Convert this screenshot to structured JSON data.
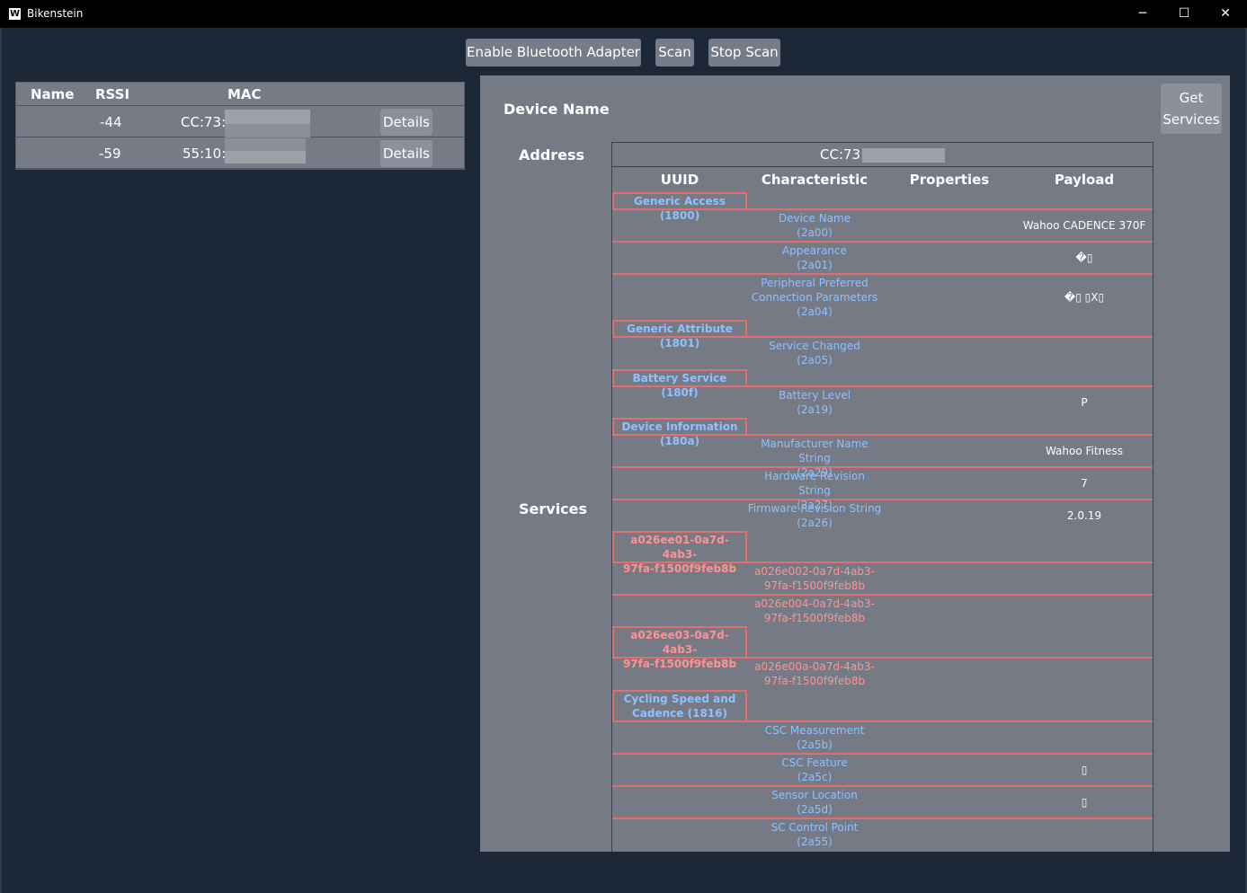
{
  "window": {
    "title": "Bikenstein",
    "icon_letter": "W",
    "minimize": "─",
    "maximize": "☐",
    "close": "✕"
  },
  "toolbar": {
    "enable_label": "Enable Bluetooth Adapter",
    "scan_label": "Scan",
    "stop_label": "Stop Scan"
  },
  "device_list": {
    "headers": {
      "name": "Name",
      "rssi": "RSSI",
      "mac": "MAC"
    },
    "rows": [
      {
        "name": "",
        "rssi": "-44",
        "mac": "CC:73:",
        "details": "Details"
      },
      {
        "name": "",
        "rssi": "-59",
        "mac": "55:10:",
        "details": "Details"
      }
    ]
  },
  "panel": {
    "device_name_label": "Device Name",
    "address_label": "Address",
    "services_label": "Services",
    "get_services_line1": "Get",
    "get_services_line2": "Services",
    "address_value": "CC:73:"
  },
  "services_table": {
    "headers": {
      "uuid": "UUID",
      "characteristic": "Characteristic",
      "properties": "Properties",
      "payload": "Payload"
    },
    "services": [
      {
        "label": "Generic Access (1800)",
        "kind": "known"
      },
      {
        "label": "Generic Attribute (1801)",
        "kind": "known"
      },
      {
        "label": "Battery Service (180f)",
        "kind": "known"
      },
      {
        "label": "Device Information (180a)",
        "kind": "known"
      },
      {
        "label_l1": "a026ee01-0a7d-4ab3-",
        "label_l2": "97fa-f1500f9feb8b",
        "kind": "custom"
      },
      {
        "label_l1": "a026ee03-0a7d-4ab3-",
        "label_l2": "97fa-f1500f9feb8b",
        "kind": "custom"
      },
      {
        "label_l1": "Cycling Speed and",
        "label_l2": "Cadence (1816)",
        "kind": "known"
      }
    ],
    "characteristics": [
      {
        "l1": "Device Name",
        "l2": "(2a00)",
        "payload": "Wahoo CADENCE 370F"
      },
      {
        "l1": "Appearance",
        "l2": "(2a01)",
        "payload": "�▯"
      },
      {
        "l1": "Peripheral Preferred",
        "l2": "Connection Parameters",
        "l3": "(2a04)",
        "payload": "�▯ ▯X▯"
      },
      {
        "l1": "Service Changed",
        "l2": "(2a05)",
        "payload": ""
      },
      {
        "l1": "Battery Level",
        "l2": "(2a19)",
        "payload": "P"
      },
      {
        "l1": "Manufacturer Name String",
        "l2": "(2a29)",
        "payload": "Wahoo Fitness"
      },
      {
        "l1": "Hardware Revision String",
        "l2": "(2a27)",
        "payload": "7"
      },
      {
        "l1": "Firmware Revision String",
        "l2": "(2a26)",
        "payload": "2.0.19"
      },
      {
        "l1": "a026e002-0a7d-4ab3-",
        "l2": "97fa-f1500f9feb8b",
        "payload": ""
      },
      {
        "l1": "a026e004-0a7d-4ab3-",
        "l2": "97fa-f1500f9feb8b",
        "payload": ""
      },
      {
        "l1": "a026e00a-0a7d-4ab3-",
        "l2": "97fa-f1500f9feb8b",
        "payload": ""
      },
      {
        "l1": "CSC Measurement",
        "l2": "(2a5b)",
        "payload": ""
      },
      {
        "l1": "CSC Feature",
        "l2": "(2a5c)",
        "payload": "▯"
      },
      {
        "l1": "Sensor Location",
        "l2": "(2a5d)",
        "payload": "▯"
      },
      {
        "l1": "SC Control Point",
        "l2": "(2a55)",
        "payload": ""
      }
    ]
  },
  "colors": {
    "background": "#1c2737",
    "panel": "#757a85",
    "accent_border": "#e07070",
    "known_uuid": "#8fc0ff",
    "custom_uuid": "#ff9393"
  }
}
